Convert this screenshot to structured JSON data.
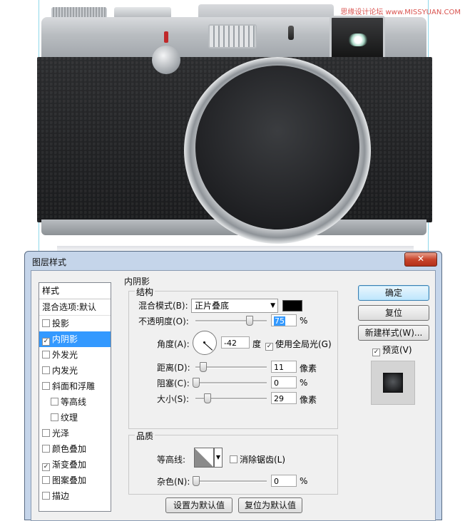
{
  "watermark": "思缘设计论坛 www.MISSYUAN.COM",
  "dialog": {
    "title": "图层样式",
    "close_icon": "✕"
  },
  "styles_list": {
    "header": "样式",
    "blend_default": "混合选项:默认",
    "items": [
      {
        "label": "投影",
        "checked": false
      },
      {
        "label": "内阴影",
        "checked": true,
        "selected": true
      },
      {
        "label": "外发光",
        "checked": false
      },
      {
        "label": "内发光",
        "checked": false
      },
      {
        "label": "斜面和浮雕",
        "checked": false
      },
      {
        "label": "等高线",
        "checked": false,
        "sub": true
      },
      {
        "label": "纹理",
        "checked": false,
        "sub": true
      },
      {
        "label": "光泽",
        "checked": false
      },
      {
        "label": "颜色叠加",
        "checked": false
      },
      {
        "label": "渐变叠加",
        "checked": true
      },
      {
        "label": "图案叠加",
        "checked": false
      },
      {
        "label": "描边",
        "checked": false
      }
    ]
  },
  "inner_shadow": {
    "section_title": "内阴影",
    "structure_title": "结构",
    "blend_mode_label": "混合模式(B):",
    "blend_mode_value": "正片叠底",
    "blend_color": "#000000",
    "opacity_label": "不透明度(O):",
    "opacity_value": "75",
    "opacity_fraction": 0.75,
    "percent": "%",
    "angle_label": "角度(A):",
    "angle_value": "-42",
    "angle_unit": "度",
    "global_light_label": "使用全局光(G)",
    "global_light_checked": true,
    "distance_label": "距离(D):",
    "distance_value": "11",
    "choke_label": "阻塞(C):",
    "choke_value": "0",
    "size_label": "大小(S):",
    "size_value": "29",
    "pixels_unit": "像素",
    "quality_title": "品质",
    "contour_label": "等高线:",
    "antialias_label": "消除锯齿(L)",
    "antialias_checked": false,
    "noise_label": "杂色(N):",
    "noise_value": "0",
    "make_default_button": "设置为默认值",
    "reset_default_button": "复位为默认值"
  },
  "buttons": {
    "ok": "确定",
    "reset": "复位",
    "new_style": "新建样式(W)...",
    "preview_label": "预览(V)",
    "preview_checked": true
  }
}
